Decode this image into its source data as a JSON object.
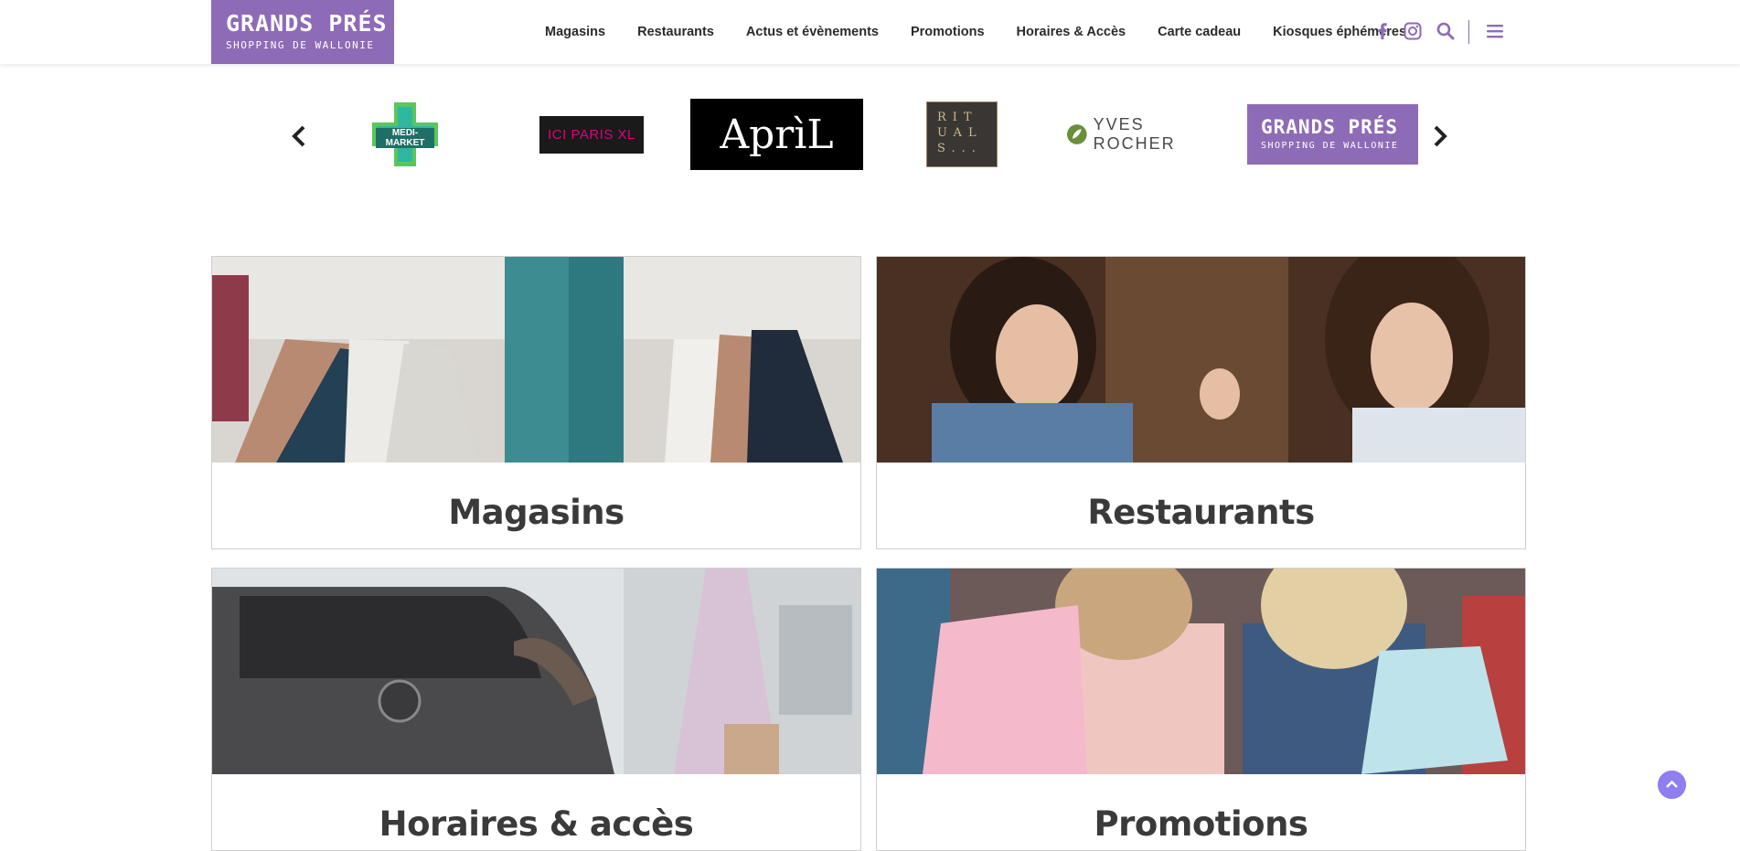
{
  "header": {
    "logo": {
      "line1": "GRANDS PRÉS",
      "line2": "SHOPPING DE WALLONIE"
    },
    "nav": [
      "Magasins",
      "Restaurants",
      "Actus et évènements",
      "Promotions",
      "Horaires & Accès",
      "Carte cadeau",
      "Kiosques éphémères"
    ],
    "icons": [
      "facebook-icon",
      "instagram-icon",
      "search-icon",
      "menu-icon"
    ]
  },
  "carousel": {
    "brands": {
      "medi": "MEDI-MARKET",
      "ici": "ICI PARIS XL",
      "april": "AprìL",
      "rituals": "RITUALS...",
      "yves": "YVES ROCHER",
      "grands_pres": {
        "line1": "GRANDS PRÉS",
        "line2": "SHOPPING DE WALLONIE"
      }
    },
    "prev_icon": "chevron-left-icon",
    "next_icon": "chevron-right-icon"
  },
  "cards": [
    {
      "title": "Magasins"
    },
    {
      "title": "Restaurants"
    },
    {
      "title": "Horaires & accès"
    },
    {
      "title": "Promotions"
    }
  ],
  "colors": {
    "brand": "#8e6bb6",
    "scroll_top": "#8f7ef0",
    "heading": "#3a3a3a"
  }
}
